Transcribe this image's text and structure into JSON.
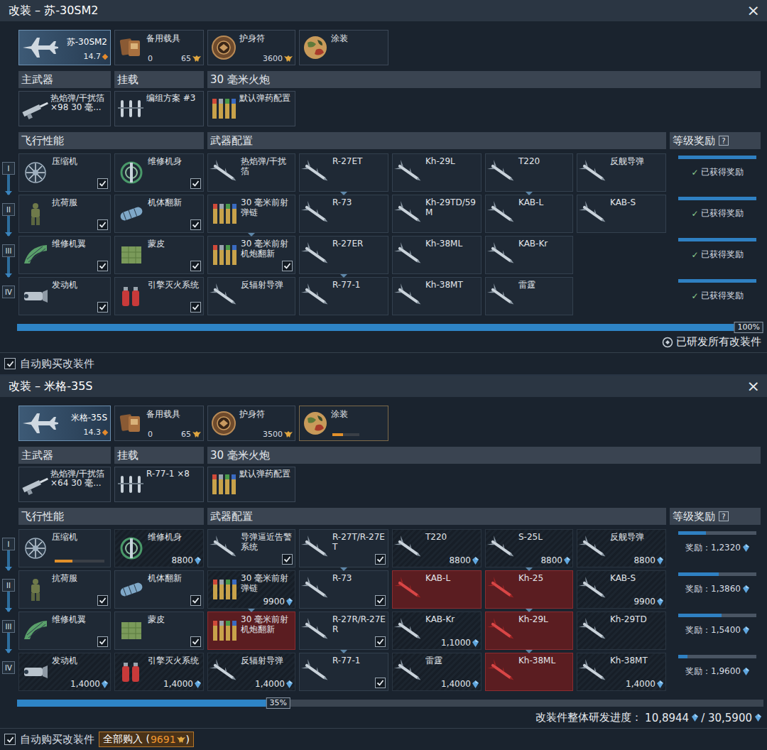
{
  "panels": [
    {
      "title": "改装 – 苏-30SM2",
      "close": "×",
      "vehicle": {
        "name": "苏-30SM2",
        "br": "14.7",
        "selected": true
      },
      "spare": {
        "label": "备用载具",
        "count": "0",
        "cost": "65"
      },
      "talisman": {
        "label": "护身符",
        "cost": "3600"
      },
      "camo": {
        "label": "涂装",
        "researching": false
      },
      "headers": [
        "主武器",
        "挂载",
        "30 毫米火炮"
      ],
      "loadout": [
        "热焰弹/干扰箔 ×98 30 毫...",
        "编组方案 #3",
        "默认弹药配置"
      ],
      "sections": {
        "flight": "飞行性能",
        "weapons": "武器配置",
        "rewards": "等级奖励",
        "help": "?"
      },
      "tiers": [
        {
          "numeral": "I",
          "flight": [
            {
              "label": "压缩机",
              "state": "normal",
              "checked": true
            },
            {
              "label": "维修机身",
              "state": "normal",
              "checked": true
            }
          ],
          "weapons": [
            {
              "label": "热焰弹/干扰箔",
              "state": "normal",
              "checked": false,
              "linked": false
            },
            {
              "label": "R-27ET",
              "state": "normal",
              "checked": false,
              "linked": true
            },
            {
              "label": "Kh-29L",
              "state": "normal",
              "checked": false,
              "linked": false
            },
            {
              "label": "T220",
              "state": "normal",
              "checked": false,
              "linked": true
            },
            {
              "label": "反舰导弹",
              "state": "normal",
              "checked": false,
              "linked": false
            }
          ],
          "reward": {
            "kind": "received",
            "mark": "✓",
            "text": "已获得奖励",
            "level": 1
          }
        },
        {
          "numeral": "II",
          "flight": [
            {
              "label": "抗荷服",
              "state": "normal",
              "checked": true
            },
            {
              "label": "机体翻新",
              "state": "normal",
              "checked": true
            }
          ],
          "weapons": [
            {
              "label": "30 毫米前射弹链",
              "state": "normal",
              "checked": false,
              "linked": true
            },
            {
              "label": "R-73",
              "state": "normal",
              "checked": false,
              "linked": false
            },
            {
              "label": "Kh-29TD/59M",
              "state": "normal",
              "checked": false,
              "linked": false
            },
            {
              "label": "KAB-L",
              "state": "normal",
              "checked": false,
              "linked": false
            },
            {
              "label": "KAB-S",
              "state": "normal",
              "checked": false,
              "linked": false
            }
          ],
          "reward": {
            "kind": "received",
            "mark": "✓",
            "text": "已获得奖励",
            "level": 1
          }
        },
        {
          "numeral": "III",
          "flight": [
            {
              "label": "维修机翼",
              "state": "normal",
              "checked": true
            },
            {
              "label": "蒙皮",
              "state": "normal",
              "checked": true
            }
          ],
          "weapons": [
            {
              "label": "30 毫米前射机炮翻新",
              "state": "normal",
              "checked": true,
              "linked": false
            },
            {
              "label": "R-27ER",
              "state": "normal",
              "checked": false,
              "linked": true
            },
            {
              "label": "Kh-38ML",
              "state": "normal",
              "checked": false,
              "linked": false
            },
            {
              "label": "KAB-Kr",
              "state": "normal",
              "checked": false,
              "linked": false
            }
          ],
          "reward": {
            "kind": "received",
            "mark": "✓",
            "text": "已获得奖励",
            "level": 1
          }
        },
        {
          "numeral": "IV",
          "flight": [
            {
              "label": "发动机",
              "state": "normal",
              "checked": true
            },
            {
              "label": "引擎灭火系统",
              "state": "normal",
              "checked": true
            }
          ],
          "weapons": [
            {
              "label": "反辐射导弹",
              "state": "normal",
              "checked": false,
              "linked": false
            },
            {
              "label": "R-77-1",
              "state": "normal",
              "checked": false,
              "linked": false
            },
            {
              "label": "Kh-38MT",
              "state": "normal",
              "checked": false,
              "linked": false
            },
            {
              "label": "雷霆",
              "state": "normal",
              "checked": false,
              "linked": false
            }
          ],
          "reward": {
            "kind": "received",
            "mark": "✓",
            "text": "已获得奖励",
            "level": 1
          }
        }
      ],
      "progress": {
        "level": 1,
        "label": "100%"
      },
      "footer": {
        "kind": "complete",
        "text": "已研发所有改装件"
      },
      "auto_buy": {
        "label": "自动购买改装件",
        "checked": true
      }
    },
    {
      "title": "改装 – 米格-35S",
      "close": "×",
      "vehicle": {
        "name": "米格-35S",
        "br": "14.3",
        "selected": true
      },
      "spare": {
        "label": "备用载具",
        "count": "0",
        "cost": "65"
      },
      "talisman": {
        "label": "护身符",
        "cost": "3500"
      },
      "camo": {
        "label": "涂装",
        "researching": true,
        "level": 0.4
      },
      "headers": [
        "主武器",
        "挂载",
        "30 毫米火炮"
      ],
      "loadout": [
        "热焰弹/干扰箔 ×64 30 毫...",
        "R-77-1 ×8",
        "默认弹药配置"
      ],
      "sections": {
        "flight": "飞行性能",
        "weapons": "武器配置",
        "rewards": "等级奖励",
        "help": "?"
      },
      "tiers": [
        {
          "numeral": "I",
          "flight": [
            {
              "label": "压缩机",
              "state": "researching",
              "checked": false,
              "level": 0.35
            },
            {
              "label": "维修机身",
              "state": "locked",
              "checked": false,
              "cost": "8800"
            }
          ],
          "weapons": [
            {
              "label": "导弹逼近告警系统",
              "state": "normal",
              "checked": true,
              "linked": false
            },
            {
              "label": "R-27T/R-27ET",
              "state": "normal",
              "checked": true,
              "linked": true
            },
            {
              "label": "T220",
              "state": "locked",
              "checked": false,
              "linked": false,
              "cost": "8800"
            },
            {
              "label": "S-25L",
              "state": "locked",
              "checked": false,
              "linked": true,
              "cost": "8800"
            },
            {
              "label": "反舰导弹",
              "state": "locked",
              "checked": false,
              "linked": false,
              "cost": "8800"
            }
          ],
          "reward": {
            "kind": "pending",
            "text": "奖励：1,2320",
            "level": 0.35
          }
        },
        {
          "numeral": "II",
          "flight": [
            {
              "label": "抗荷服",
              "state": "normal",
              "checked": true
            },
            {
              "label": "机体翻新",
              "state": "normal",
              "checked": true
            }
          ],
          "weapons": [
            {
              "label": "30 毫米前射弹链",
              "state": "locked",
              "checked": false,
              "linked": true,
              "cost": "9900"
            },
            {
              "label": "R-73",
              "state": "normal",
              "checked": true,
              "linked": false
            },
            {
              "label": "KAB-L",
              "state": "blocked",
              "checked": false,
              "linked": false
            },
            {
              "label": "Kh-25",
              "state": "blocked",
              "checked": false,
              "linked": true
            },
            {
              "label": "KAB-S",
              "state": "locked",
              "checked": false,
              "linked": false,
              "cost": "9900"
            }
          ],
          "reward": {
            "kind": "pending",
            "text": "奖励：1,3860",
            "level": 0.52
          }
        },
        {
          "numeral": "III",
          "flight": [
            {
              "label": "维修机翼",
              "state": "normal",
              "checked": true
            },
            {
              "label": "蒙皮",
              "state": "normal",
              "checked": true
            }
          ],
          "weapons": [
            {
              "label": "30 毫米前射机炮翻新",
              "state": "blocked",
              "checked": false,
              "linked": false
            },
            {
              "label": "R-27R/R-27ER",
              "state": "normal",
              "checked": true,
              "linked": true
            },
            {
              "label": "KAB-Kr",
              "state": "locked",
              "checked": false,
              "linked": false,
              "cost": "1,1000"
            },
            {
              "label": "Kh-29L",
              "state": "blocked",
              "checked": false,
              "linked": true
            },
            {
              "label": "Kh-29TD",
              "state": "locked",
              "checked": false,
              "linked": false
            }
          ],
          "reward": {
            "kind": "pending",
            "text": "奖励：1,5400",
            "level": 0.55
          }
        },
        {
          "numeral": "IV",
          "flight": [
            {
              "label": "发动机",
              "state": "locked",
              "checked": false,
              "cost": "1,4000"
            },
            {
              "label": "引擎灭火系统",
              "state": "locked",
              "checked": false,
              "cost": "1,4000"
            }
          ],
          "weapons": [
            {
              "label": "反辐射导弹",
              "state": "locked",
              "checked": false,
              "linked": false,
              "cost": "1,4000"
            },
            {
              "label": "R-77-1",
              "state": "normal",
              "checked": true,
              "linked": false
            },
            {
              "label": "雷霆",
              "state": "locked",
              "checked": false,
              "linked": false,
              "cost": "1,4000"
            },
            {
              "label": "Kh-38ML",
              "state": "blocked",
              "checked": false,
              "linked": false
            },
            {
              "label": "Kh-38MT",
              "state": "locked",
              "checked": false,
              "linked": false,
              "cost": "1,4000"
            }
          ],
          "reward": {
            "kind": "pending",
            "text": "奖励：1,9600",
            "level": 0.12
          }
        }
      ],
      "progress": {
        "level": 0.35,
        "label": "35%"
      },
      "footer": {
        "kind": "progress",
        "label": "改装件整体研发进度：",
        "done": "10,8944",
        "total": "/ 30,5900"
      },
      "auto_buy": {
        "label": "自动购买改装件",
        "checked": true
      },
      "buy_all": {
        "label": "全部购入 (",
        "cost": "9691",
        "end": ")"
      }
    }
  ]
}
